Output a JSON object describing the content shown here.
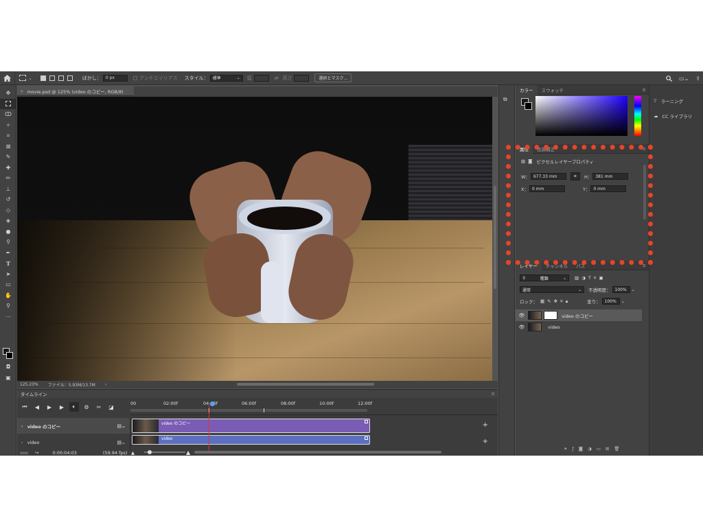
{
  "options_bar": {
    "feather_label": "ぼかし：",
    "feather_value": "0 px",
    "antialias_label": "アンチエイリアス",
    "style_label": "スタイル：",
    "style_value": "標準",
    "width_label": "幅",
    "height_label": "高さ",
    "mask_button": "選択とマスク..."
  },
  "document": {
    "tab_title": "movie.psd @ 125% (video のコピー, RGB/8)",
    "zoom": "125.23%",
    "file_info": "ファイル：5.93M/13.7M"
  },
  "timeline": {
    "title": "タイムライン",
    "ruler": [
      "00",
      "02:00f",
      "04:00f",
      "06:00f",
      "08:00f",
      "10:00f",
      "12:00f"
    ],
    "tracks": [
      {
        "label": "video のコピー",
        "clip": "video のコピー",
        "clip_color": "#7b5cb4"
      },
      {
        "label": "video",
        "clip": "video",
        "clip_color": "#5d6fbf"
      }
    ],
    "timecode": "0:00:04:03",
    "fps": "(59.94 fps)"
  },
  "color_panel": {
    "tabs": [
      "カラー",
      "スウォッチ"
    ]
  },
  "properties_panel": {
    "tabs": [
      "属性",
      "色調補正"
    ],
    "subtitle": "ピクセルレイヤープロパティ",
    "w_label": "W：",
    "w_value": "677.33 mm",
    "h_label": "H：",
    "h_value": "381 mm",
    "x_label": "X：",
    "x_value": "0 mm",
    "y_label": "Y：",
    "y_value": "0 mm"
  },
  "layers_panel": {
    "tabs": [
      "レイヤー",
      "チャンネル",
      "パス"
    ],
    "filter_label": "種類",
    "blend_mode": "通常",
    "opacity_label": "不透明度：",
    "opacity_value": "100%",
    "lock_label": "ロック：",
    "fill_label": "塗り：",
    "fill_value": "100%",
    "layers": [
      {
        "name": "video のコピー",
        "selected": true
      },
      {
        "name": "video",
        "selected": false
      }
    ]
  },
  "right_column": {
    "items": [
      "ラーニング",
      "CC ライブラリ"
    ]
  },
  "colors": {
    "highlight": "#e8442b",
    "panel": "#424242",
    "playhead": "#d23a3a"
  }
}
